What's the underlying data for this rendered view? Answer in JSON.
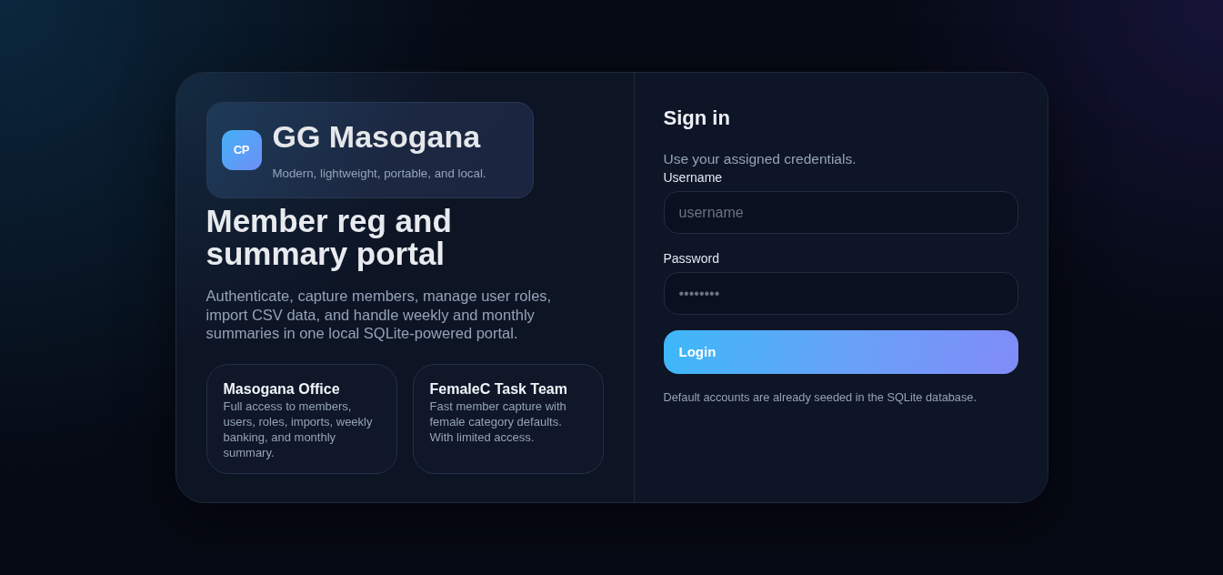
{
  "brand": {
    "logo": "CP",
    "name": "GG Masogana",
    "tagline": "Modern, lightweight, portable, and local."
  },
  "hero": {
    "title": "Member reg and summary portal",
    "description": "Authenticate, capture members, manage user roles, import CSV data, and handle weekly and monthly summaries in one local SQLite-powered portal."
  },
  "roles": [
    {
      "title": "Masogana Office",
      "description": "Full access to members, users, roles, imports, weekly banking, and monthly summary."
    },
    {
      "title": "FemaleC Task Team",
      "description": "Fast member capture with female category defaults. With limited access."
    }
  ],
  "sign_in": {
    "title": "Sign in",
    "subtitle": "Use your assigned credentials.",
    "fields": [
      {
        "label": "Username",
        "placeholder": "username"
      },
      {
        "label": "Password",
        "placeholder": "••••••••"
      }
    ],
    "button": "Login",
    "note": "Default accounts are already seeded in the SQLite database."
  }
}
